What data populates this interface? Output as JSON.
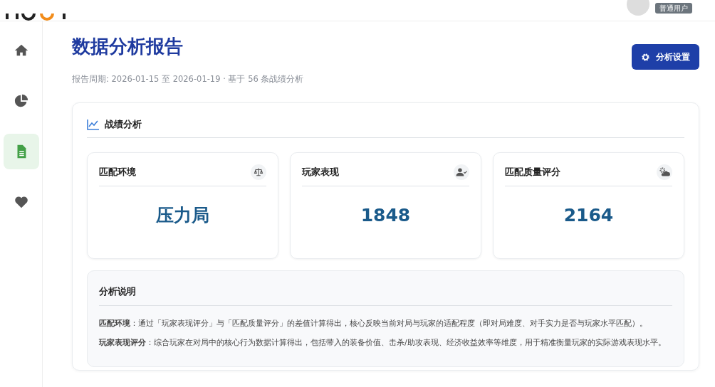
{
  "header": {
    "user_badge": "普通用户"
  },
  "sidebar": {
    "items": [
      {
        "selected": false
      },
      {
        "selected": false
      },
      {
        "selected": true
      },
      {
        "selected": false
      }
    ]
  },
  "page": {
    "title": "数据分析报告",
    "subtitle": "报告周期: 2026-01-15 至 2026-01-19 · 基于 56 条战绩分析",
    "settings_button": "分析设置"
  },
  "analysis": {
    "title": "战绩分析",
    "stats": [
      {
        "label": "匹配环境",
        "value": "压力局"
      },
      {
        "label": "玩家表现",
        "value": "1848"
      },
      {
        "label": "匹配质量评分",
        "value": "2164"
      }
    ],
    "explanation": {
      "title": "分析说明",
      "paragraphs": [
        "**匹配环境**：通过「玩家表现评分」与「匹配质量评分」的差值计算得出，核心反映当前对局与玩家的适配程度（即对局难度、对手实力是否与玩家水平匹配）。",
        "**玩家表现评分**：综合玩家在对局中的核心行为数据计算得出，包括带入的装备价值、击杀/助攻表现、经济收益效率等维度，用于精准衡量玩家的实际游戏表现水平。"
      ]
    }
  }
}
